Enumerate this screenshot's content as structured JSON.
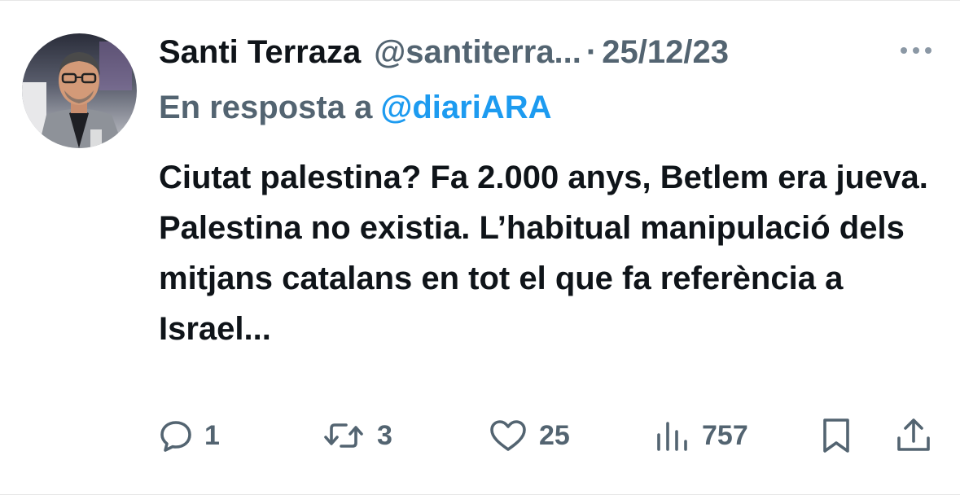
{
  "author": {
    "name": "Santi Terraza",
    "handle": "@santiterra...",
    "separator": "·",
    "date": "25/12/23"
  },
  "reply": {
    "prefix": "En resposta a",
    "mention": "@diariARA"
  },
  "tweet": {
    "text": "Ciutat palestina? Fa 2.000 anys, Betlem era jueva. Palestina no existia. L’habitual manipulació dels mitjans catalans en tot el que fa referència a Israel..."
  },
  "actions": {
    "replies": "1",
    "retweets": "3",
    "likes": "25",
    "views": "757"
  },
  "icons": {
    "more": "more-horizontal-icon",
    "reply": "reply-bubble-icon",
    "retweet": "retweet-icon",
    "like": "heart-icon",
    "views": "views-bar-icon",
    "bookmark": "bookmark-icon",
    "share": "share-icon"
  },
  "colors": {
    "text": "#0f1419",
    "secondary": "#536471",
    "link": "#1d9bf0"
  }
}
